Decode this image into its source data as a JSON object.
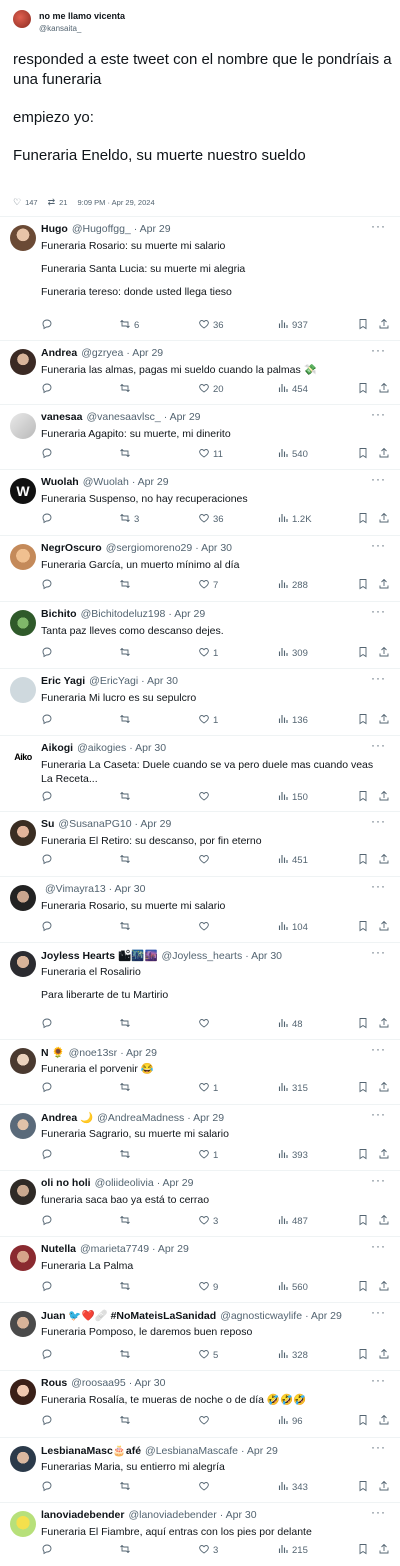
{
  "main_tweet": {
    "name": "no me llamo vicenta",
    "handle": "@kansaita_",
    "lines": [
      "responded a este tweet con el nombre que le pondríais a una funeraria",
      "empiezo yo:",
      "Funeraria Eneldo, su muerte nuestro sueldo"
    ],
    "likes": "147",
    "retweets": "21",
    "timestamp": "9:09 PM · Apr 29, 2024"
  },
  "more_glyph": "···",
  "replies": [
    {
      "name": "Hugo",
      "handle": "@Hugoffgg_",
      "date": "· Apr 29",
      "lines": [
        "Funeraria Rosario: su muerte mi salario",
        "Funeraria Santa Lucia: su muerte mi alegria",
        "Funeraria tereso: donde usted llega tieso"
      ],
      "reply_count": "",
      "retweets": "6",
      "likes": "36",
      "views": "937"
    },
    {
      "name": "Andrea",
      "handle": "@gzryea",
      "date": "· Apr 29",
      "lines": [
        "Funeraria las almas, pagas mi sueldo cuando la palmas 💸"
      ],
      "reply_count": "",
      "retweets": "",
      "likes": "20",
      "views": "454"
    },
    {
      "name": "vanesaa",
      "handle": "@vanesaavlsc_",
      "date": "· Apr 29",
      "lines": [
        "Funeraria Agapito: su muerte, mi dinerito"
      ],
      "reply_count": "",
      "retweets": "",
      "likes": "11",
      "views": "540"
    },
    {
      "name": "Wuolah",
      "handle": "@Wuolah",
      "date": "· Apr 29",
      "lines": [
        "Funeraria Suspenso, no hay recuperaciones"
      ],
      "reply_count": "",
      "retweets": "3",
      "likes": "36",
      "views": "1.2K"
    },
    {
      "name": "NegrOscuro",
      "handle": "@sergiomoreno29",
      "date": "· Apr 30",
      "lines": [
        "Funeraria García, un muerto mínimo al día"
      ],
      "reply_count": "",
      "retweets": "",
      "likes": "7",
      "views": "288"
    },
    {
      "name": "Bichito",
      "handle": "@Bichitodeluz198",
      "date": "· Apr 29",
      "lines": [
        "Tanta paz lleves como descanso dejes."
      ],
      "reply_count": "",
      "retweets": "",
      "likes": "1",
      "views": "309"
    },
    {
      "name": "Eric Yagi",
      "handle": "@EricYagi",
      "date": "· Apr 30",
      "lines": [
        "Funeraria Mi lucro es su sepulcro"
      ],
      "reply_count": "",
      "retweets": "",
      "likes": "1",
      "views": "136"
    },
    {
      "name": "Aikogi",
      "handle": "@aikogies",
      "date": "· Apr 30",
      "lines": [
        "Funeraria La Caseta: Duele cuando se va pero duele mas cuando veas La Receta..."
      ],
      "reply_count": "",
      "retweets": "",
      "likes": "",
      "views": "150"
    },
    {
      "name": "Su",
      "handle": "@SusanaPG10",
      "date": "· Apr 29",
      "lines": [
        "Funeraria El Retiro: su descanso, por fin eterno"
      ],
      "reply_count": "",
      "retweets": "",
      "likes": "",
      "views": "451"
    },
    {
      "name": "",
      "handle": "@Vimayra13",
      "date": "· Apr 30",
      "lines": [
        "Funeraria Rosario, su muerte mi salario"
      ],
      "reply_count": "",
      "retweets": "",
      "likes": "",
      "views": "104"
    },
    {
      "name": "Joyless Hearts 🏙🌃🌆",
      "handle": "@Joyless_hearts",
      "date": "· Apr 30",
      "lines": [
        "Funeraria el Rosalirio",
        "Para liberarte de tu Martirio"
      ],
      "reply_count": "",
      "retweets": "",
      "likes": "",
      "views": "48"
    },
    {
      "name": "N 🌻",
      "handle": "@noe13sr",
      "date": "· Apr 29",
      "lines": [
        "Funeraria el porvenir 😂"
      ],
      "reply_count": "",
      "retweets": "",
      "likes": "1",
      "views": "315"
    },
    {
      "name": "Andrea 🌙",
      "handle": "@AndreaMadness",
      "date": "· Apr 29",
      "lines": [
        "Funeraria Sagrario, su muerte mi salario"
      ],
      "reply_count": "",
      "retweets": "",
      "likes": "1",
      "views": "393"
    },
    {
      "name": "oli no holi",
      "handle": "@oliideolivia",
      "date": "· Apr 29",
      "lines": [
        "funeraria saca bao ya está to cerrao"
      ],
      "reply_count": "",
      "retweets": "",
      "likes": "3",
      "views": "487"
    },
    {
      "name": "Nutella",
      "handle": "@marieta7749",
      "date": "· Apr 29",
      "lines": [
        "Funeraria La Palma"
      ],
      "reply_count": "",
      "retweets": "",
      "likes": "9",
      "views": "560"
    },
    {
      "name": "Juan 🐦❤️🩹 #NoMateisLaSanidad",
      "handle": "@agnosticwaylife",
      "date": "· Apr 29",
      "lines": [
        "Funeraria Pomposo, le daremos buen reposo"
      ],
      "reply_count": "",
      "retweets": "",
      "likes": "5",
      "views": "328"
    },
    {
      "name": "Rous",
      "handle": "@roosaa95",
      "date": "· Apr 30",
      "lines": [
        "Funeraria Rosalía, te mueras de noche o de día 🤣🤣🤣"
      ],
      "reply_count": "",
      "retweets": "",
      "likes": "",
      "views": "96"
    },
    {
      "name": "LesbianaMasc🎂afé",
      "handle": "@LesbianaMascafe",
      "date": "· Apr 29",
      "lines": [
        "Funerarias Maria, su entierro mi alegría"
      ],
      "reply_count": "",
      "retweets": "",
      "likes": "",
      "views": "343"
    },
    {
      "name": "lanoviadebender",
      "handle": "@lanoviadebender",
      "date": "· Apr 30",
      "lines": [
        "Funeraria El Fiambre, aquí entras con los pies por delante"
      ],
      "reply_count": "",
      "retweets": "",
      "likes": "3",
      "views": "215"
    }
  ]
}
